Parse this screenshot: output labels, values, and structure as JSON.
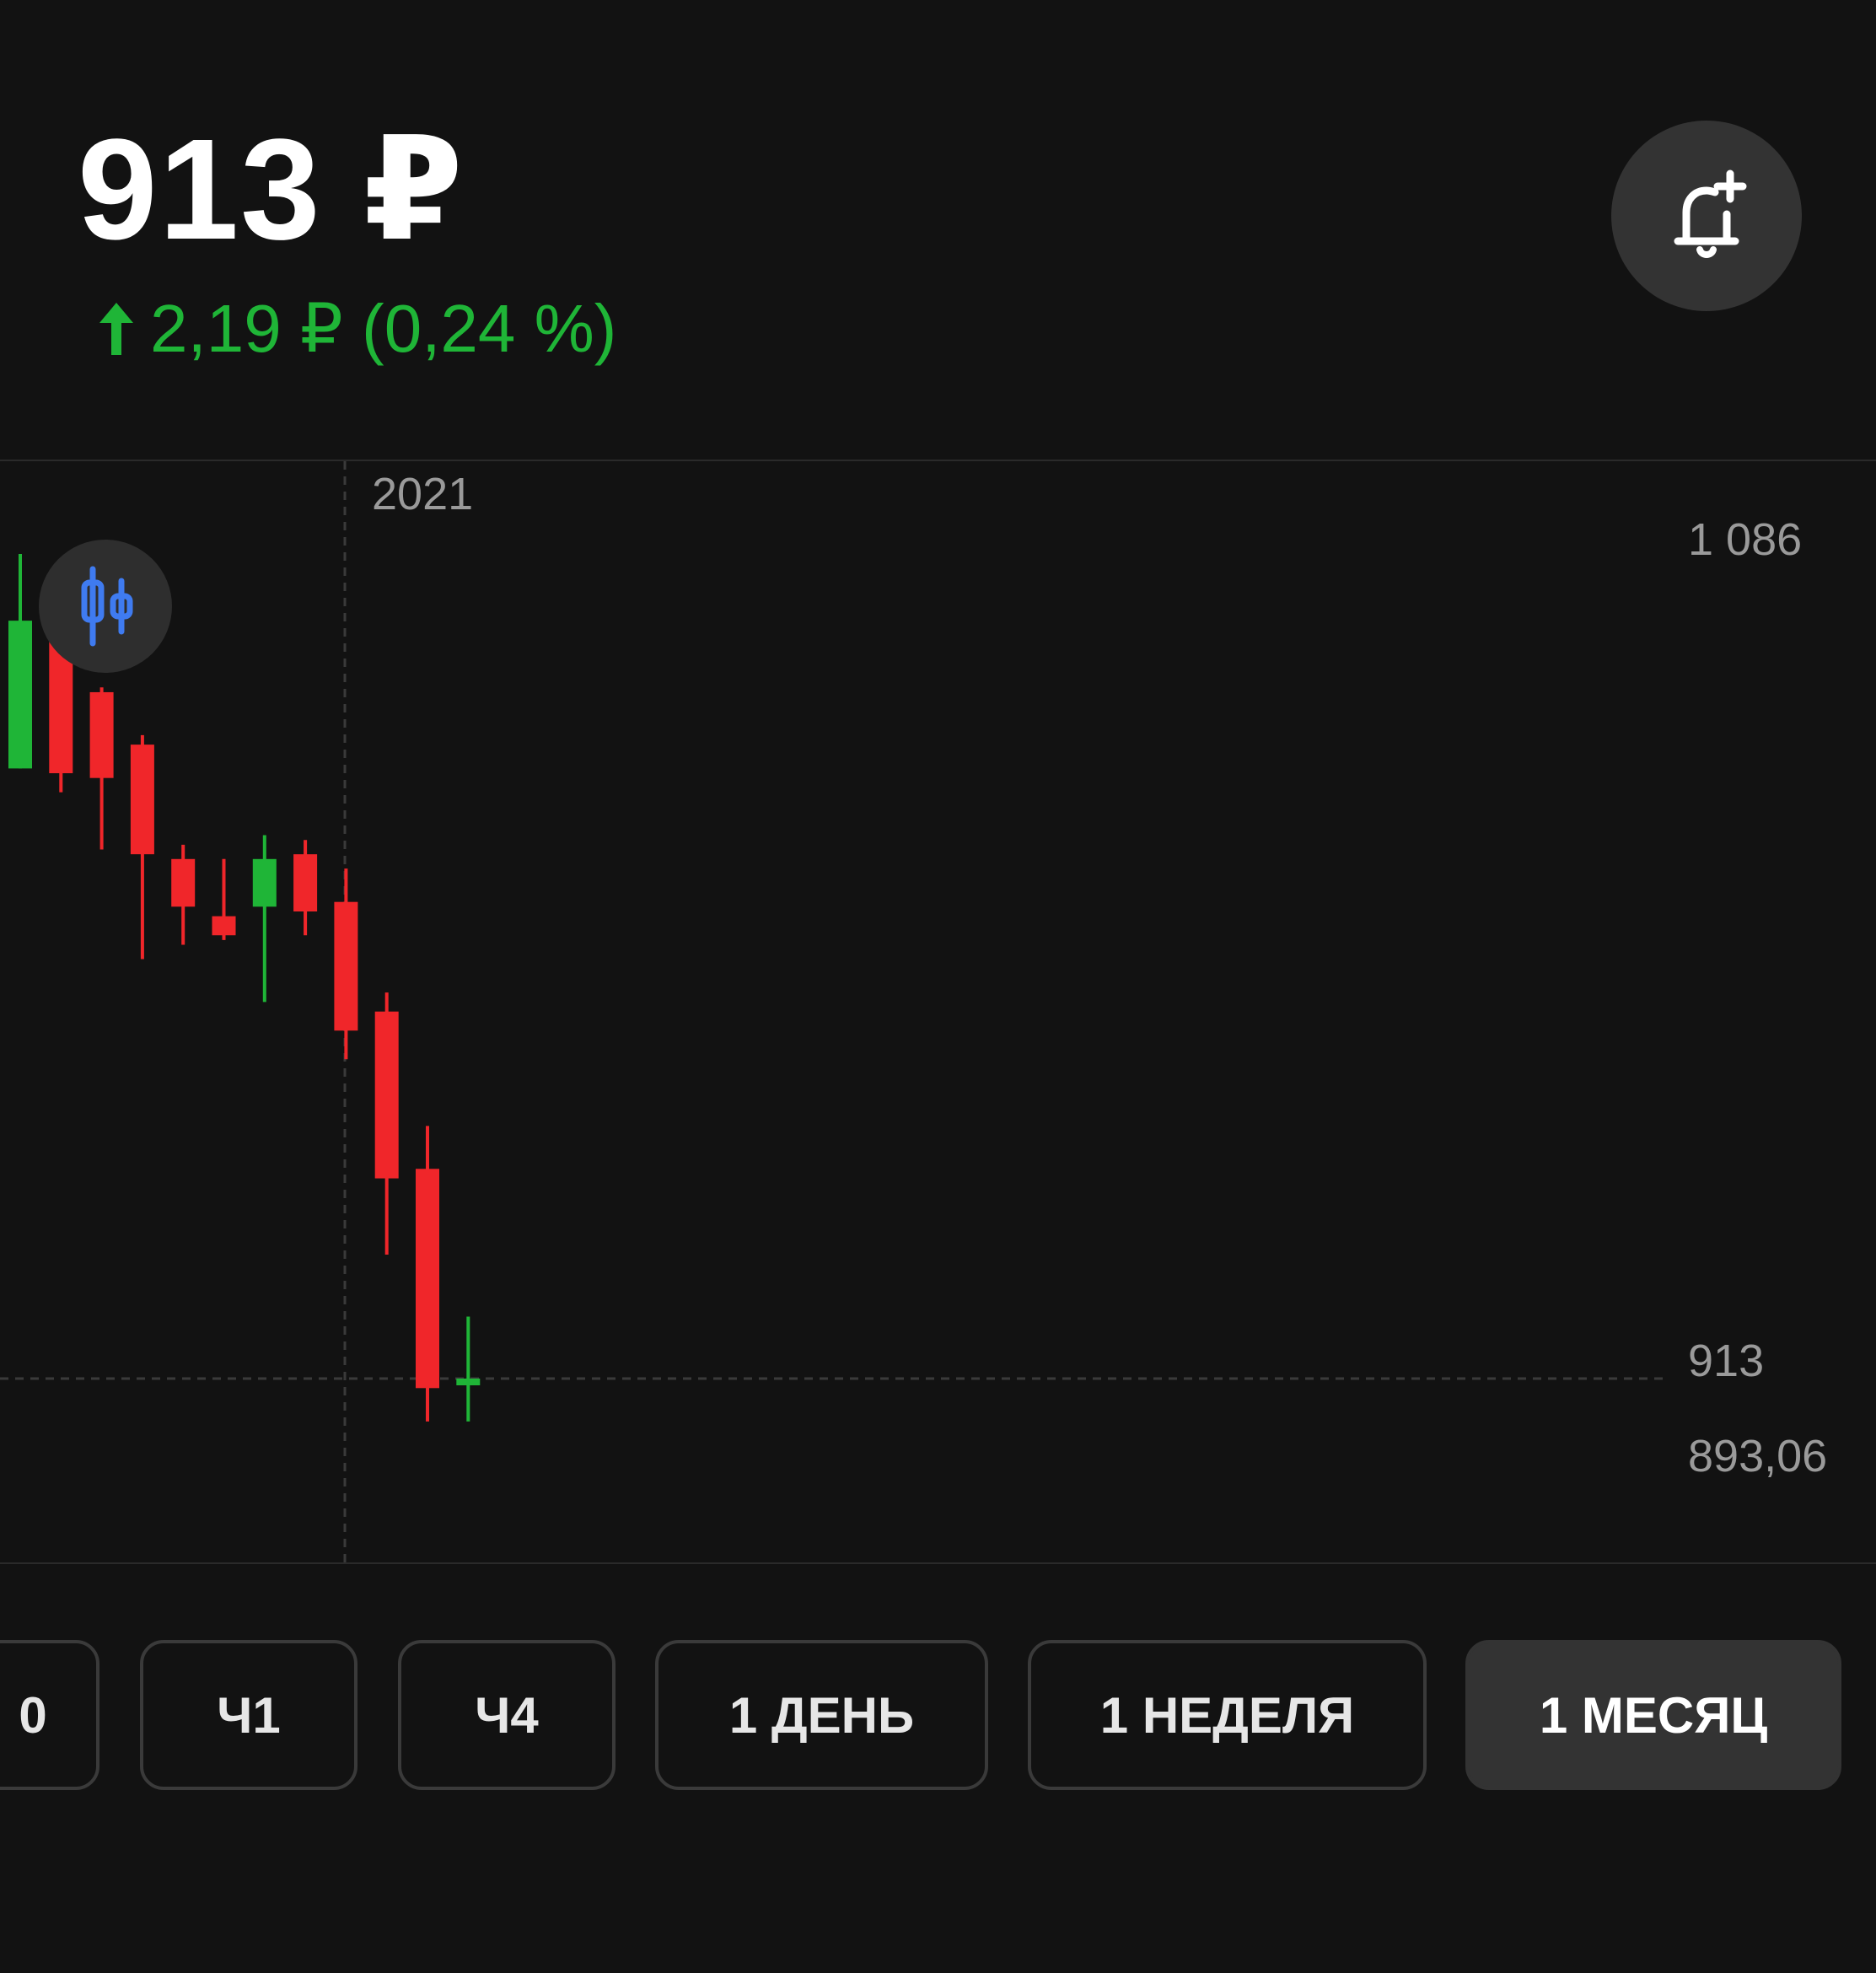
{
  "header": {
    "price": "913 ₽",
    "change_text": "2,19 ₽ (0,24 %)",
    "change_direction": "up",
    "change_color": "#1fb537",
    "alert_button_icon": "bell-plus-icon"
  },
  "chart_controls": {
    "type_toggle_icon": "candlestick-icon"
  },
  "chart_data": {
    "type": "candlestick",
    "period": "1 МЕСЯЦ",
    "year_marker": "2021",
    "y_tick_labels": [
      "1 086",
      "913",
      "893,06"
    ],
    "current_price": 913,
    "visible_high": 1086,
    "visible_low": 893.06,
    "ylim": [
      893.06,
      1086
    ],
    "up_color": "#1fb537",
    "down_color": "#f0262a",
    "candles": [
      {
        "open": 1041,
        "high": 1086,
        "low": 1041,
        "close": 1072,
        "direction": "up"
      },
      {
        "open": 1068,
        "high": 1058,
        "low": 1036,
        "close": 1040,
        "direction": "down"
      },
      {
        "open": 1057,
        "high": 1058,
        "low": 1024,
        "close": 1039,
        "direction": "down"
      },
      {
        "open": 1046,
        "high": 1048,
        "low": 1001,
        "close": 1023,
        "direction": "down"
      },
      {
        "open": 1022,
        "high": 1025,
        "low": 1004,
        "close": 1012,
        "direction": "down"
      },
      {
        "open": 1010,
        "high": 1022,
        "low": 1005,
        "close": 1006,
        "direction": "down"
      },
      {
        "open": 1012,
        "high": 1027,
        "low": 992,
        "close": 1022,
        "direction": "up"
      },
      {
        "open": 1023,
        "high": 1026,
        "low": 1006,
        "close": 1011,
        "direction": "down"
      },
      {
        "open": 1013,
        "high": 1020,
        "low": 980,
        "close": 986,
        "direction": "down"
      },
      {
        "open": 990,
        "high": 994,
        "low": 939,
        "close": 955,
        "direction": "down"
      },
      {
        "open": 957,
        "high": 966,
        "low": 904,
        "close": 911,
        "direction": "down"
      },
      {
        "open": 912,
        "high": 926,
        "low": 904,
        "close": 913,
        "direction": "up"
      }
    ]
  },
  "periods": [
    {
      "label": "0",
      "active": false
    },
    {
      "label": "Ч1",
      "active": false
    },
    {
      "label": "Ч4",
      "active": false
    },
    {
      "label": "1 ДЕНЬ",
      "active": false
    },
    {
      "label": "1 НЕДЕЛЯ",
      "active": false
    },
    {
      "label": "1 МЕСЯЦ",
      "active": true
    }
  ]
}
